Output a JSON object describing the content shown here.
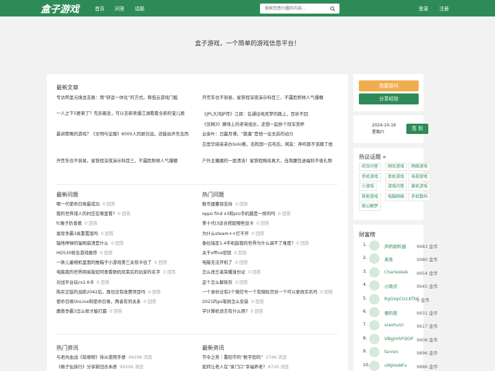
{
  "header": {
    "logo": "盒子游戏",
    "nav": [
      "首页",
      "问答",
      "话题"
    ],
    "search_placeholder": "搜索您感兴趣的内容...",
    "login": "登录",
    "register": "注册"
  },
  "hero": "盒子游戏，一个简单的游戏信息平台！",
  "latest_articles": {
    "title": "最新文章",
    "left": [
      "专访阿里元境龙志勇：用“研运一体化”的方式，降低云游戏门槛",
      "一人之下5要来了？先别着急，可以去新美僵江湖看看全新的宝儿姐",
      "最讲策略的游戏？《文明与征服》6000人同屏对战，还能玩声东击西",
      "开荒车也不容易，星铁程深夜演示科目三，不露脸照样人气爆棚"
    ],
    "right": [
      "开荒车也不容易，星铁程深夜演示科目三，不露脸照样人气爆棚",
      "《JPL大鸿炉传》江郎：在通往电竞梦的路上，百折不回",
      "《剑网3》赛场上的老将组合，还想一起拚个冠军奖杯",
      "云染叶：日赢月薄，“憨墨”是他一往无前的动力",
      "吕思华骑弟弟办Solo赛，击败国一吕布后，网友：神鸡管不该蹭了他",
      "户外主播圈的一股清流！星铁程格局真大，自掏腰包送福利不收礼物"
    ]
  },
  "latest_questions": {
    "title": "最新问题",
    "items": [
      {
        "t": "哪一代使命召唤最成功",
        "c": "0 回答"
      },
      {
        "t": "我的世界煤人的村庄在哪里看?",
        "c": "0 回答"
      },
      {
        "t": "fc猴子扔香蕉",
        "c": "0 回答"
      },
      {
        "t": "星际争霸3具重置版吗",
        "c": "0 回答"
      },
      {
        "t": "辐地停弹的辐地崩溃是什么",
        "c": "0 回答"
      },
      {
        "t": "HD530射击游戏推荐",
        "c": "0 回答"
      },
      {
        "t": "一款儿童相机里面的推箱子小游戏第三关就卡住了",
        "c": "0 回答"
      },
      {
        "t": "电脑我的世界网易版如何查看联机结束后的玩家的名字",
        "c": "0 回答"
      },
      {
        "t": "对战平台玩cs1.6卡",
        "c": "0 回答"
      },
      {
        "t": "购买正版的战绝2042后，再也没有收费项目吗",
        "c": "0 回答"
      },
      {
        "t": "使命召唤OnLine和使命召唤，两者有何关系",
        "c": "0 回答"
      },
      {
        "t": "魔兽争霸3怎么样才能打赢",
        "c": "0 回答"
      }
    ]
  },
  "hot_questions": {
    "title": "热门问题",
    "items": [
      {
        "t": "数币器董容支持",
        "c": "0 回答"
      },
      {
        "t": "oppo find x3和pro手机膜是一样的吗",
        "c": "0 回答"
      },
      {
        "t": "第十代i3适合搭配哪些显卡",
        "c": "0 回答"
      },
      {
        "t": "为什么steam++打不开",
        "c": "0 回答"
      },
      {
        "t": "泰拉瑞亚1.4手机版我的世界为什么调不了难度?",
        "c": "0 回答"
      },
      {
        "t": "关于office密钥",
        "c": "0 回答"
      },
      {
        "t": "电脑无法开机了",
        "c": "0 回答"
      },
      {
        "t": "怎么改王者荣耀身份证",
        "c": "0 回答"
      },
      {
        "t": "这个怎么解除苏",
        "c": "0 回答"
      },
      {
        "t": "一个身份证有2个微信号一个有微粒贷另一个可以更改实名吗",
        "c": "0 回答"
      },
      {
        "t": "2021的ps笔刷怎么安装",
        "c": "0 回答"
      },
      {
        "t": "学计算机语言有什么用?",
        "c": "0 回答"
      }
    ]
  },
  "hot_news": {
    "title": "热门资讯",
    "items": [
      {
        "t": "与君共血战《琅琊榜》侍从使用手册",
        "c": "99298 浏览"
      },
      {
        "t": "《格子仙侠行》分享新回合本质",
        "c": "99296 浏览"
      }
    ]
  },
  "latest_news": {
    "title": "最新资讯",
    "items": [
      {
        "t": "节令之美｜重阳节的“数字密码”",
        "c": "2746 浏览"
      },
      {
        "t": "如何让老人在“家门口”幸福养老?",
        "c": "8726 浏览"
      }
    ]
  },
  "sidebar": {
    "ask": "我要提问",
    "share": "分享经验",
    "date": "2024-10-19",
    "weekday": "星期六",
    "checkin": "签 到",
    "topics_title": "热议话题 »",
    "topics": [
      "综合问答",
      "网页游戏",
      "网络游戏",
      "手机游戏",
      "单机游戏",
      "电视游戏",
      "小游戏",
      "游戏问答",
      "掌机游戏",
      "其他游戏",
      "电脑网络",
      "手机数码",
      "商公解梦"
    ],
    "rich_title": "财富榜",
    "rich": [
      {
        "n": "声桥助听器",
        "c": "9983 金币"
      },
      {
        "n": "芙美",
        "c": "9980 金币"
      },
      {
        "n": "Charleskek",
        "c": "9954 金币"
      },
      {
        "n": "小雨点",
        "c": "9945 金币"
      },
      {
        "n": "RgGVpCtcLKTbE",
        "c": "0 金币"
      },
      {
        "n": "傻的歌",
        "c": "9931 金币"
      },
      {
        "n": "xiaohuizi",
        "c": "9917 金币"
      },
      {
        "n": "VBgJmhFQGP",
        "c": "9906 金币"
      },
      {
        "n": "fanren",
        "c": "9896 金币"
      },
      {
        "n": "vlRJHoMFv",
        "c": "9886 金币"
      }
    ]
  },
  "colors": {
    "brand": "#2e8b57",
    "ask_btn": "#f0ad4e",
    "share_btn": "#2e8b57"
  }
}
